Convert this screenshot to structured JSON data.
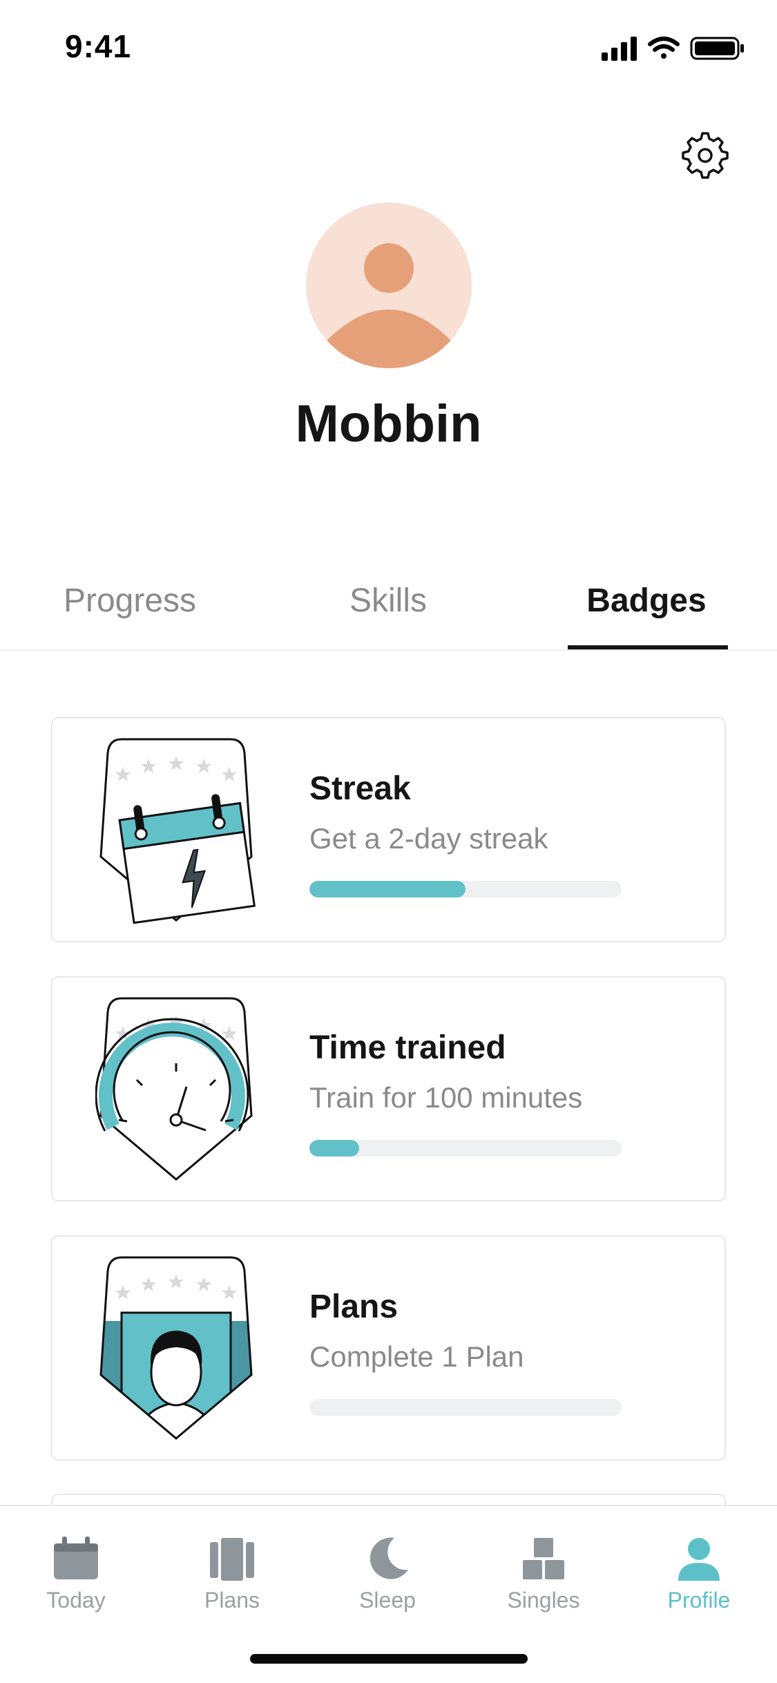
{
  "status_bar": {
    "time": "9:41"
  },
  "profile": {
    "name": "Mobbin"
  },
  "tabs": [
    {
      "label": "Progress",
      "active": false
    },
    {
      "label": "Skills",
      "active": false
    },
    {
      "label": "Badges",
      "active": true
    }
  ],
  "badges": [
    {
      "title": "Streak",
      "subtitle": "Get a 2-day streak",
      "progress": 0.5,
      "icon": "calendar-badge-icon"
    },
    {
      "title": "Time trained",
      "subtitle": "Train for 100 minutes",
      "progress": 0.16,
      "icon": "clock-badge-icon"
    },
    {
      "title": "Plans",
      "subtitle": "Complete 1 Plan",
      "progress": 0.0,
      "icon": "plans-badge-icon"
    }
  ],
  "nav": [
    {
      "label": "Today",
      "icon": "calendar-icon",
      "active": false
    },
    {
      "label": "Plans",
      "icon": "plans-icon",
      "active": false
    },
    {
      "label": "Sleep",
      "icon": "moon-icon",
      "active": false
    },
    {
      "label": "Singles",
      "icon": "blocks-icon",
      "active": false
    },
    {
      "label": "Profile",
      "icon": "person-icon",
      "active": true
    }
  ],
  "colors": {
    "accent": "#62c0c8",
    "avatar_bg": "#f8e0d5",
    "avatar_fg": "#e6a079",
    "inactive": "#9aa0a6"
  }
}
